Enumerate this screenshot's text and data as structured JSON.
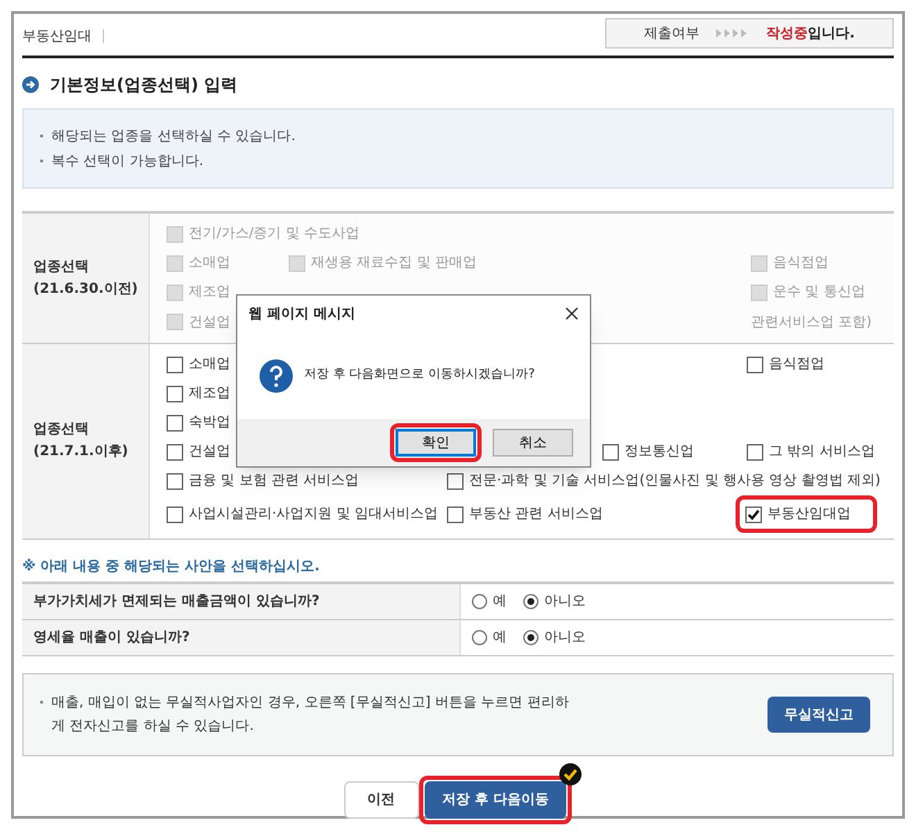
{
  "header": {
    "title": "부동산임대",
    "status_label": "제출여부",
    "status_value": "작성중",
    "status_suffix": "입니다."
  },
  "section_title": "기본정보(업종선택) 입력",
  "info_lines": [
    "해당되는 업종을 선택하실 수 있습니다.",
    "복수 선택이 가능합니다."
  ],
  "industry_groups": [
    {
      "label": "업종선택",
      "sublabel": "(21.6.30.이전)",
      "disabled": true,
      "kind": "old",
      "rows": [
        [
          {
            "label": "전기/가스/증기 및 수도사업",
            "checked": false,
            "highlighted": false
          }
        ],
        [
          {
            "label": "소매업",
            "checked": false,
            "highlighted": false
          },
          {
            "label": "재생용 재료수집 및 판매업",
            "checked": false,
            "highlighted": false
          },
          null,
          {
            "label": "음식점업",
            "checked": false,
            "highlighted": false
          }
        ],
        [
          {
            "label": "제조업",
            "checked": false,
            "highlighted": false
          },
          null,
          null,
          {
            "label": "운수 및 통신업",
            "checked": false,
            "highlighted": false
          }
        ],
        [
          {
            "label": "건설업",
            "checked": false,
            "highlighted": false
          },
          null,
          null,
          {
            "kind": "text",
            "label": "관련서비스업 포함)"
          }
        ]
      ]
    },
    {
      "label": "업종선택",
      "sublabel": "(21.7.1.이후)",
      "disabled": false,
      "kind": "new",
      "rows": [
        [
          {
            "label": "소매업",
            "checked": false,
            "highlighted": false
          },
          null,
          null,
          {
            "label": "음식점업",
            "checked": false,
            "highlighted": false
          }
        ],
        [
          {
            "label": "제조업",
            "checked": false,
            "highlighted": false
          }
        ],
        [
          {
            "label": "숙박업",
            "checked": false,
            "highlighted": false
          }
        ],
        [
          {
            "label": "건설업",
            "checked": false,
            "highlighted": false
          },
          null,
          {
            "label": "정보통신업",
            "checked": false,
            "highlighted": false
          },
          {
            "label": "그 밖의 서비스업",
            "checked": false,
            "highlighted": false
          }
        ],
        [
          {
            "label": "금융 및 보험 관련 서비스업",
            "checked": false,
            "highlighted": false
          },
          {
            "label": "전문·과학 및 기술 서비스업(인물사진 및 행사용 영상 촬영법 제외)",
            "checked": false,
            "highlighted": false
          }
        ],
        [
          {
            "label": "사업시설관리·사업지원 및 임대서비스업",
            "checked": false,
            "highlighted": false
          },
          {
            "label": "부동산 관련 서비스업",
            "checked": false,
            "highlighted": false
          },
          null,
          {
            "label": "부동산임대업",
            "checked": true,
            "highlighted": true
          }
        ]
      ]
    }
  ],
  "notice": "※ 아래 내용 중 해당되는 사안을 선택하십시오.",
  "questions": [
    {
      "text": "부가가치세가 면제되는 매출금액이 있습니까?",
      "options": [
        {
          "label": "예",
          "selected": false
        },
        {
          "label": "아니오",
          "selected": true
        }
      ]
    },
    {
      "text": "영세율 매출이 있습니까?",
      "options": [
        {
          "label": "예",
          "selected": false
        },
        {
          "label": "아니오",
          "selected": true
        }
      ]
    }
  ],
  "no_sales": {
    "text": "매출, 매입이 없는 무실적사업자인 경우, 오른쪽 [무실적신고] 버튼을 누르면 편리하게 전자신고를 하실 수 있습니다.",
    "button": "무실적신고"
  },
  "footer_buttons": [
    {
      "label": "이전",
      "kind": "secondary",
      "highlighted": false
    },
    {
      "label": "저장 후 다음이동",
      "kind": "primary",
      "highlighted": true
    }
  ],
  "dialog": {
    "title": "웹 페이지 메시지",
    "message": "저장 후 다음화면으로 이동하시겠습니까?",
    "buttons": [
      {
        "label": "확인",
        "selected": true,
        "highlighted": true
      },
      {
        "label": "취소",
        "selected": false,
        "highlighted": false
      }
    ]
  }
}
